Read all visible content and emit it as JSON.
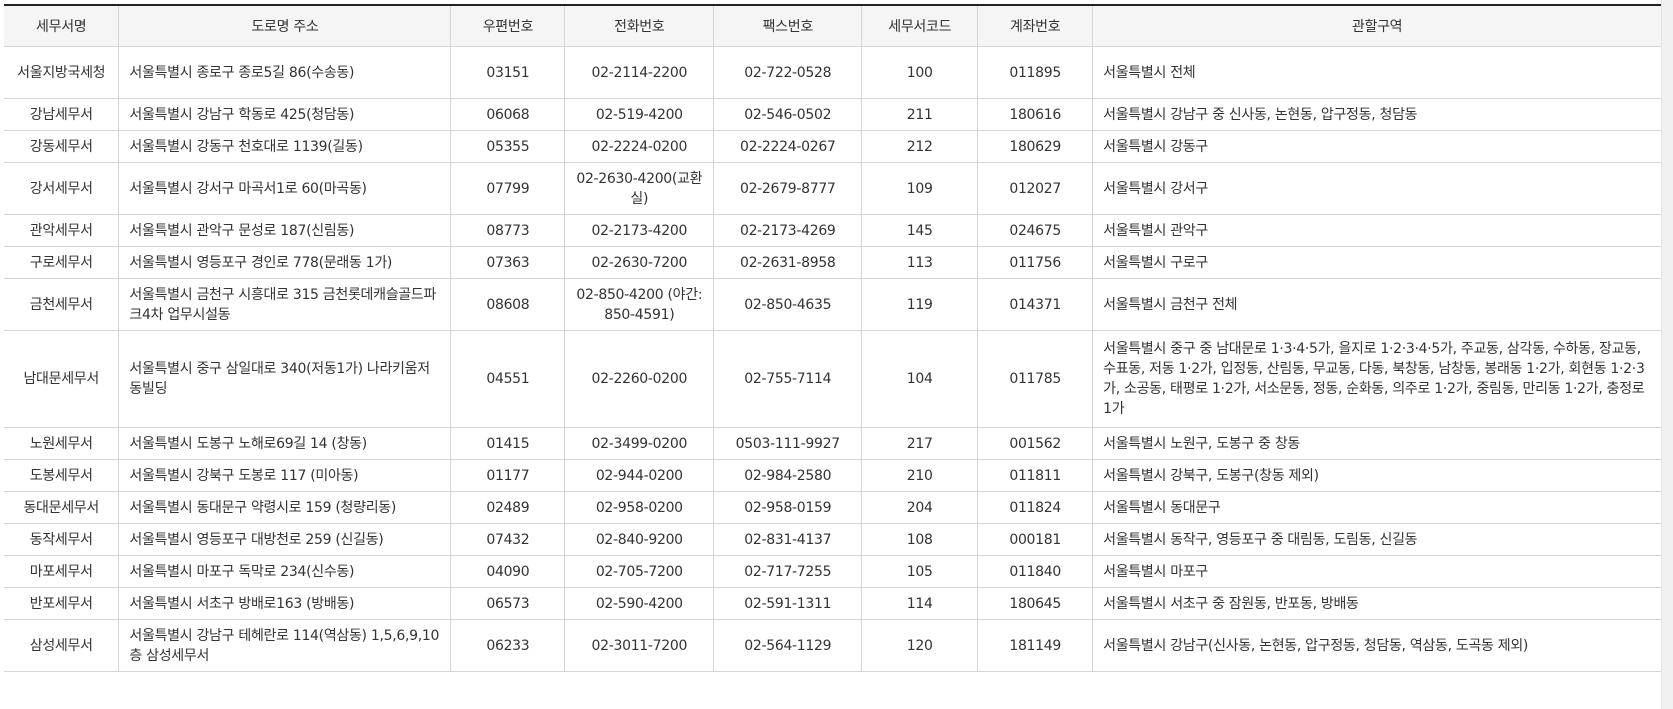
{
  "table": {
    "headers": [
      "세무서명",
      "도로명 주소",
      "우편번호",
      "전화번호",
      "팩스번호",
      "세무서코드",
      "계좌번호",
      "관할구역"
    ],
    "rows": [
      {
        "name": "서울지방국세청",
        "address": "서울특별시 종로구 종로5길 86(수송동)",
        "zip": "03151",
        "phone": "02-2114-2200",
        "fax": "02-722-0528",
        "code": "100",
        "account": "011895",
        "area": "서울특별시 전체"
      },
      {
        "name": "강남세무서",
        "address": "서울특별시 강남구 학동로 425(청담동)",
        "zip": "06068",
        "phone": "02-519-4200",
        "fax": "02-546-0502",
        "code": "211",
        "account": "180616",
        "area": "서울특별시 강남구 중 신사동, 논현동, 압구정동, 청담동"
      },
      {
        "name": "강동세무서",
        "address": "서울특별시 강동구 천호대로 1139(길동)",
        "zip": "05355",
        "phone": "02-2224-0200",
        "fax": "02-2224-0267",
        "code": "212",
        "account": "180629",
        "area": "서울특별시 강동구"
      },
      {
        "name": "강서세무서",
        "address": "서울특별시 강서구 마곡서1로 60(마곡동)",
        "zip": "07799",
        "phone": "02-2630-4200(교환실)",
        "fax": "02-2679-8777",
        "code": "109",
        "account": "012027",
        "area": "서울특별시 강서구"
      },
      {
        "name": "관악세무서",
        "address": "서울특별시 관악구 문성로 187(신림동)",
        "zip": "08773",
        "phone": "02-2173-4200",
        "fax": "02-2173-4269",
        "code": "145",
        "account": "024675",
        "area": "서울특별시 관악구"
      },
      {
        "name": "구로세무서",
        "address": "서울특별시 영등포구 경인로 778(문래동 1가)",
        "zip": "07363",
        "phone": "02-2630-7200",
        "fax": "02-2631-8958",
        "code": "113",
        "account": "011756",
        "area": "서울특별시 구로구"
      },
      {
        "name": "금천세무서",
        "address": "서울특별시 금천구 시흥대로 315 금천롯데캐슬골드파크4차 업무시설동",
        "zip": "08608",
        "phone": "02-850-4200 (야간:850-4591)",
        "fax": "02-850-4635",
        "code": "119",
        "account": "014371",
        "area": "서울특별시 금천구 전체"
      },
      {
        "name": "남대문세무서",
        "address": "서울특별시 중구 삼일대로 340(저동1가) 나라키움저동빌딩",
        "zip": "04551",
        "phone": "02-2260-0200",
        "fax": "02-755-7114",
        "code": "104",
        "account": "011785",
        "area": "서울특별시 중구 중 남대문로 1·3·4·5가, 을지로 1·2·3·4·5가, 주교동, 삼각동, 수하동, 장교동, 수표동, 저동 1·2가, 입정동, 산림동, 무교동, 다동, 북창동, 남창동, 봉래동 1·2가, 회현동 1·2·3가, 소공동, 태평로 1·2가, 서소문동, 정동, 순화동, 의주로 1·2가, 중림동, 만리동 1·2가, 충정로 1가"
      },
      {
        "name": "노원세무서",
        "address": "서울특별시 도봉구 노해로69길 14 (창동)",
        "zip": "01415",
        "phone": "02-3499-0200",
        "fax": "0503-111-9927",
        "code": "217",
        "account": "001562",
        "area": "서울특별시 노원구, 도봉구 중 창동"
      },
      {
        "name": "도봉세무서",
        "address": "서울특별시 강북구 도봉로 117 (미아동)",
        "zip": "01177",
        "phone": "02-944-0200",
        "fax": "02-984-2580",
        "code": "210",
        "account": "011811",
        "area": "서울특별시 강북구, 도봉구(창동 제외)"
      },
      {
        "name": "동대문세무서",
        "address": "서울특별시 동대문구 약령시로 159 (청량리동)",
        "zip": "02489",
        "phone": "02-958-0200",
        "fax": "02-958-0159",
        "code": "204",
        "account": "011824",
        "area": "서울특별시 동대문구"
      },
      {
        "name": "동작세무서",
        "address": "서울특별시 영등포구 대방천로 259 (신길동)",
        "zip": "07432",
        "phone": "02-840-9200",
        "fax": "02-831-4137",
        "code": "108",
        "account": "000181",
        "area": "서울특별시 동작구, 영등포구 중 대림동, 도림동, 신길동"
      },
      {
        "name": "마포세무서",
        "address": "서울특별시 마포구 독막로 234(신수동)",
        "zip": "04090",
        "phone": "02-705-7200",
        "fax": "02-717-7255",
        "code": "105",
        "account": "011840",
        "area": "서울특별시 마포구"
      },
      {
        "name": "반포세무서",
        "address": "서울특별시 서초구 방배로163 (방배동)",
        "zip": "06573",
        "phone": "02-590-4200",
        "fax": "02-591-1311",
        "code": "114",
        "account": "180645",
        "area": "서울특별시 서초구 중 잠원동, 반포동, 방배동"
      },
      {
        "name": "삼성세무서",
        "address": "서울특별시 강남구 테헤란로 114(역삼동) 1,5,6,9,10층 삼성세무서",
        "zip": "06233",
        "phone": "02-3011-7200",
        "fax": "02-564-1129",
        "code": "120",
        "account": "181149",
        "area": "서울특별시 강남구(신사동, 논현동, 압구정동, 청담동, 역삼동, 도곡동 제외)"
      }
    ]
  }
}
